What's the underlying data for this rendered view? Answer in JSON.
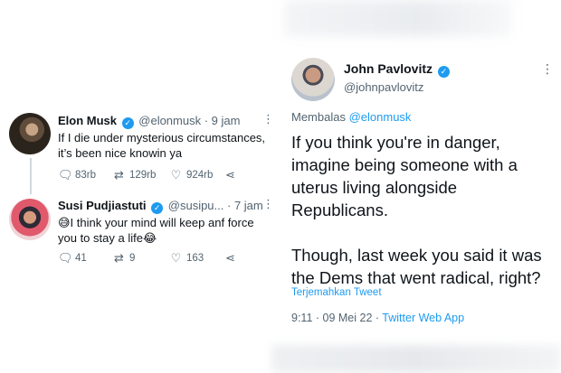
{
  "left_thread": [
    {
      "name": "Elon Musk",
      "handle": "@elonmusk",
      "time": "· 9 jam",
      "text_line1": "If I die under mysterious circumstances,",
      "text_line2": "it’s been nice knowin ya",
      "replies": "83rb",
      "retweets": "129rb",
      "likes": "924rb"
    },
    {
      "name": "Susi Pudjiastuti",
      "handle": "@susipu...",
      "time": "· 7 jam",
      "text_line1": "😅I think your mind will keep anf force",
      "text_line2": "you to stay a life😂",
      "replies": "41",
      "retweets": "9",
      "likes": "163"
    }
  ],
  "right_tweet": {
    "name": "John Pavlovitz",
    "handle": "@johnpavlovitz",
    "reply_prefix": "Membalas",
    "reply_mention": "@elonmusk",
    "paragraph1": "If you think you're in danger, imagine being someone with a uterus living alongside Republicans.",
    "paragraph2": "Though, last week you said it was the Dems that went radical, right?",
    "translate_label": "Terjemahkan Tweet",
    "timestamp": "9:11 · 09 Mei 22 ·",
    "app": "Twitter Web App"
  },
  "icons": {
    "more": "more-dots-icon",
    "verified": "verified-badge-icon",
    "reply": "reply-bubble-icon",
    "retweet": "retweet-icon",
    "like": "heart-icon",
    "share": "share-icon"
  },
  "colors": {
    "accent": "#1d9bf0",
    "text": "#0f1419",
    "muted": "#536471"
  }
}
